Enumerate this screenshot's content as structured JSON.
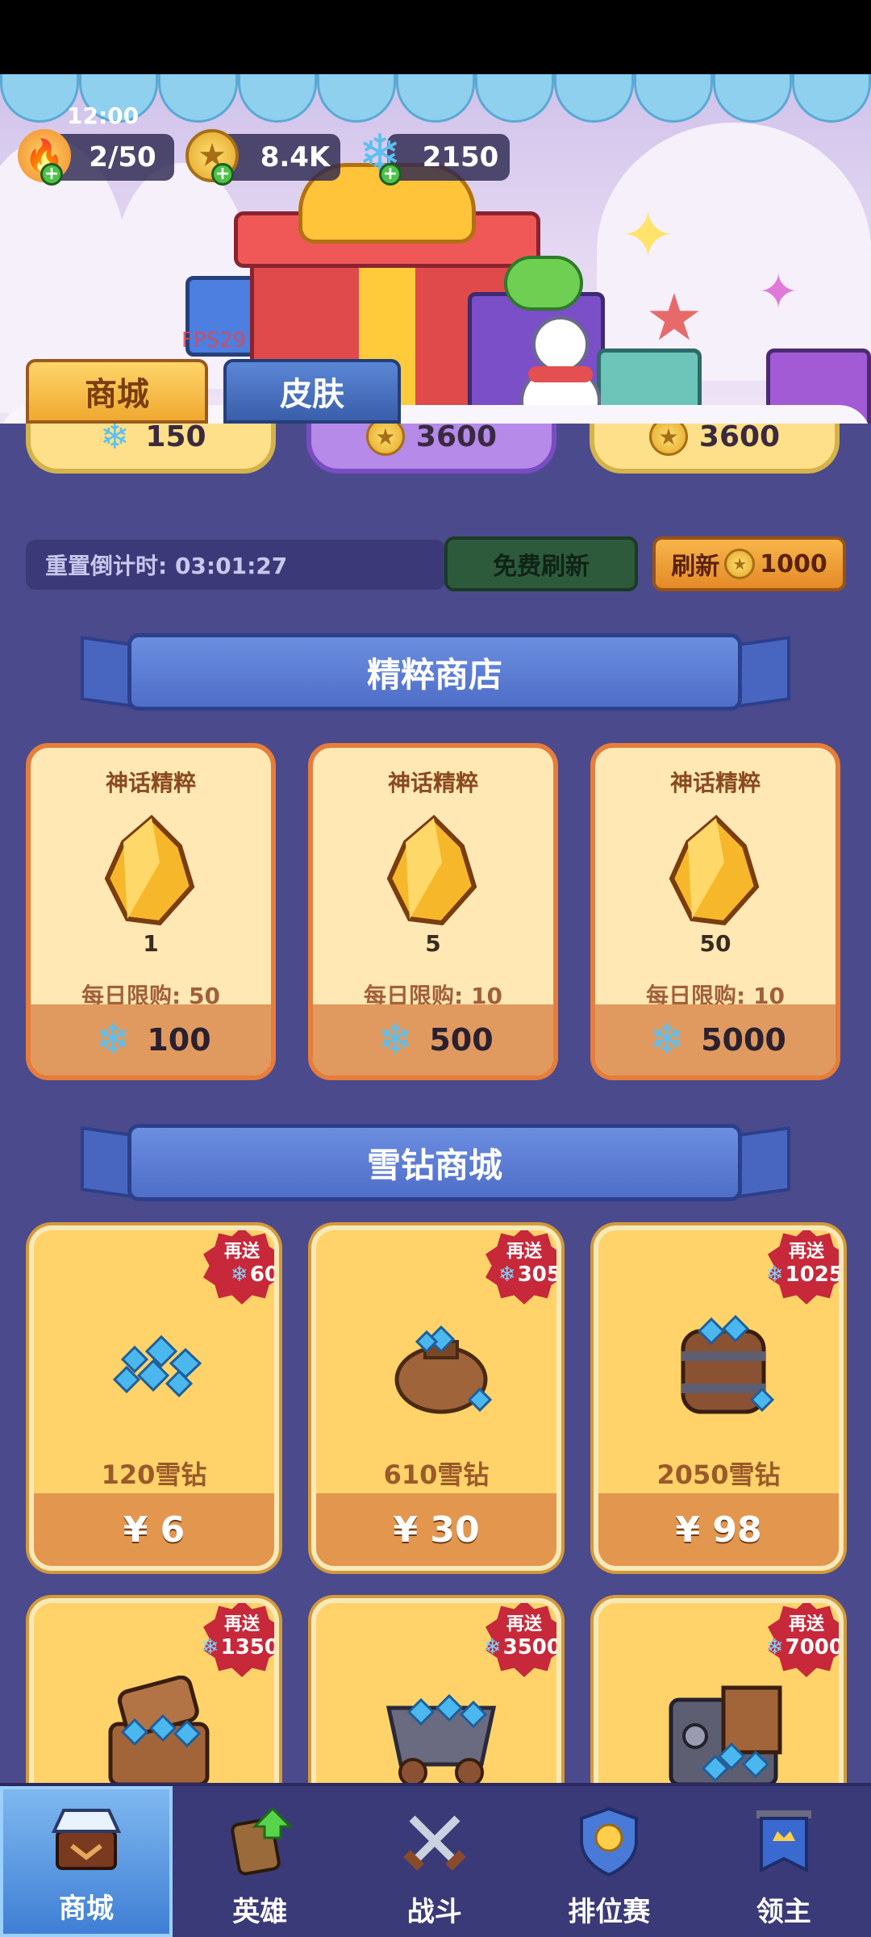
{
  "hud": {
    "clock": "12:00",
    "stamina": "2/50",
    "coins": "8.4K",
    "diamonds": "2150",
    "fps": "FPS29"
  },
  "tabs": {
    "shop": "商城",
    "skin": "皮肤"
  },
  "top_cards": [
    {
      "price": "150",
      "currency": "snowflake-icon"
    },
    {
      "price": "3600",
      "currency": "coin-icon"
    },
    {
      "price": "3600",
      "currency": "coin-icon"
    }
  ],
  "refresh": {
    "countdown": "重置倒计时: 03:01:27",
    "free_label": "免费刷新",
    "paid_label": "刷新",
    "paid_cost": "1000"
  },
  "essence_shop": {
    "title": "精粹商店",
    "items": [
      {
        "name": "神话精粹",
        "qty": "1",
        "limit": "每日限购: 50",
        "price": "100"
      },
      {
        "name": "神话精粹",
        "qty": "5",
        "limit": "每日限购: 10",
        "price": "500"
      },
      {
        "name": "神话精粹",
        "qty": "50",
        "limit": "每日限购: 10",
        "price": "5000"
      }
    ]
  },
  "diamond_shop": {
    "title": "雪钻商城",
    "bonus_label": "再送",
    "items": [
      {
        "label": "120雪钻",
        "price": "¥ 6",
        "bonus": "60"
      },
      {
        "label": "610雪钻",
        "price": "¥ 30",
        "bonus": "305"
      },
      {
        "label": "2050雪钻",
        "price": "¥ 98",
        "bonus": "1025"
      },
      {
        "label": "",
        "price": "",
        "bonus": "1350"
      },
      {
        "label": "",
        "price": "",
        "bonus": "3500"
      },
      {
        "label": "",
        "price": "",
        "bonus": "7000"
      }
    ]
  },
  "nav": {
    "items": [
      {
        "label": "商城",
        "icon": "shop-icon"
      },
      {
        "label": "英雄",
        "icon": "hero-card-icon"
      },
      {
        "label": "战斗",
        "icon": "crossed-swords-icon"
      },
      {
        "label": "排位赛",
        "icon": "rank-shield-icon"
      },
      {
        "label": "领主",
        "icon": "lord-banner-icon"
      }
    ]
  },
  "colors": {
    "background": "#4b4a8c",
    "accent_orange": "#e67d3a",
    "card_gold": "#ffd36a",
    "diamond_blue": "#5ac0f0",
    "badge_red": "#c7283a"
  }
}
